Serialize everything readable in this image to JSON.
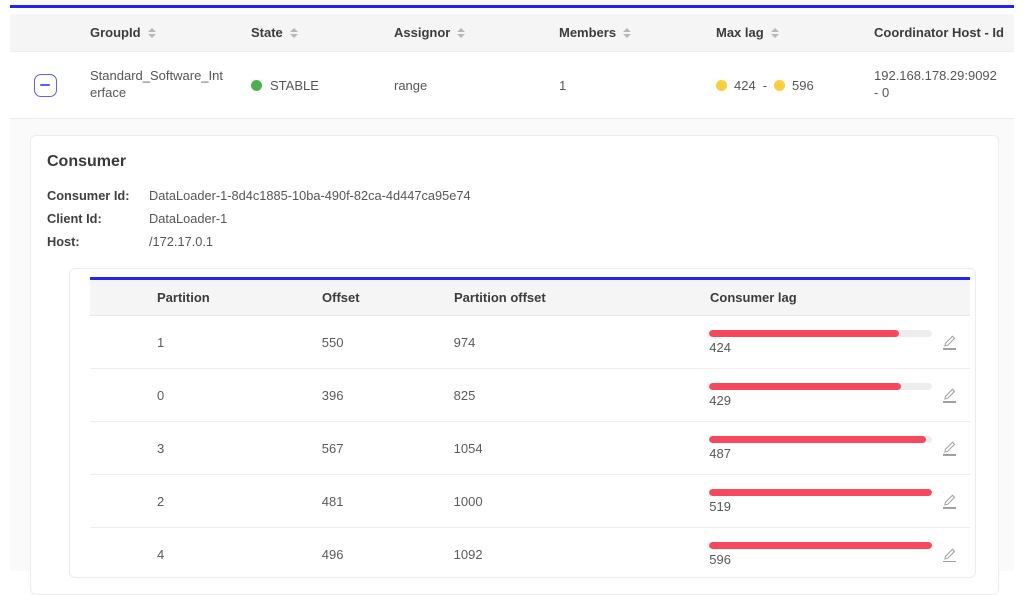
{
  "colors": {
    "accent_blue": "#2424ef",
    "expand_blue": "#5c5cff",
    "state_green": "#4caf50",
    "lag_yellow": "#f8ce39",
    "lag_red": "#f8485e"
  },
  "groups_table": {
    "columns": [
      {
        "label": "GroupId",
        "sortable": true
      },
      {
        "label": "State",
        "sortable": true
      },
      {
        "label": "Assignor",
        "sortable": true
      },
      {
        "label": "Members",
        "sortable": true
      },
      {
        "label": "Max lag",
        "sortable": true
      },
      {
        "label": "Coordinator Host - Id",
        "sortable": false
      }
    ],
    "row": {
      "group_id": "Standard_Software_Interface",
      "state": "STABLE",
      "assignor": "range",
      "members": "1",
      "max_lag_min": "424",
      "max_lag_separator": "-",
      "max_lag_max": "596",
      "coordinator_host_id": "192.168.178.29:9092 - 0"
    }
  },
  "consumer_card": {
    "title": "Consumer",
    "details": [
      {
        "label": "Consumer Id:",
        "value": "DataLoader-1-8d4c1885-10ba-490f-82ca-4d447ca95e74"
      },
      {
        "label": "Client Id:",
        "value": "DataLoader-1"
      },
      {
        "label": "Host:",
        "value": "/172.17.0.1"
      }
    ],
    "partitions_table": {
      "columns": [
        "Partition",
        "Offset",
        "Partition offset",
        "Consumer lag"
      ],
      "rows": [
        {
          "partition": "1",
          "offset": "550",
          "partition_offset": "974",
          "lag": "424",
          "lag_bar_pct": 85
        },
        {
          "partition": "0",
          "offset": "396",
          "partition_offset": "825",
          "lag": "429",
          "lag_bar_pct": 86
        },
        {
          "partition": "3",
          "offset": "567",
          "partition_offset": "1054",
          "lag": "487",
          "lag_bar_pct": 97
        },
        {
          "partition": "2",
          "offset": "481",
          "partition_offset": "1000",
          "lag": "519",
          "lag_bar_pct": 100
        },
        {
          "partition": "4",
          "offset": "496",
          "partition_offset": "1092",
          "lag": "596",
          "lag_bar_pct": 100
        }
      ]
    }
  }
}
